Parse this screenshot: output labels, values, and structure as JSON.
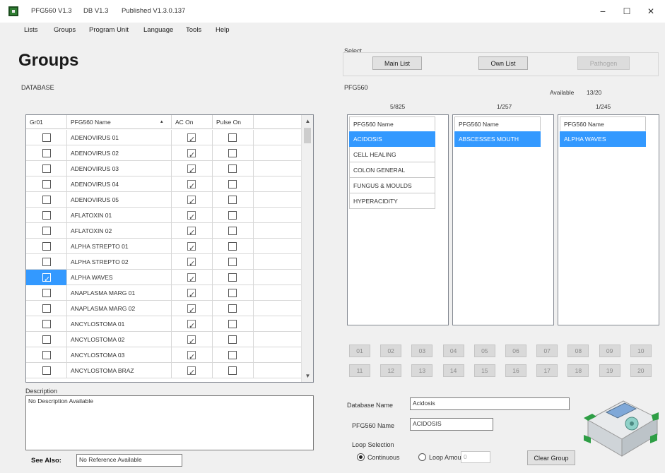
{
  "titlebar": {
    "app_version": "PFG560 V1.3",
    "db_version": "DB V1.3",
    "published": "Published V1.3.0.137",
    "minimize": "−",
    "maximize": "☐",
    "close": "✕"
  },
  "menu": [
    "Lists",
    "Groups",
    "Program Unit",
    "Language",
    "Tools",
    "Help"
  ],
  "page_title": "Groups",
  "database_label": "DATABASE",
  "select": {
    "label": "Select",
    "main_list": "Main List",
    "own_list": "Own List",
    "pathogen": "Pathogen"
  },
  "grid": {
    "headers": [
      "Gr01",
      "PFG560 Name",
      "▴",
      "AC On",
      "Pulse On"
    ],
    "rows": [
      {
        "gr": false,
        "name": "ADENOVIRUS 01",
        "ac": true,
        "pulse": false
      },
      {
        "gr": false,
        "name": "ADENOVIRUS 02",
        "ac": true,
        "pulse": false
      },
      {
        "gr": false,
        "name": "ADENOVIRUS 03",
        "ac": true,
        "pulse": false
      },
      {
        "gr": false,
        "name": "ADENOVIRUS 04",
        "ac": true,
        "pulse": false
      },
      {
        "gr": false,
        "name": "ADENOVIRUS 05",
        "ac": true,
        "pulse": false
      },
      {
        "gr": false,
        "name": "AFLATOXIN 01",
        "ac": true,
        "pulse": false
      },
      {
        "gr": false,
        "name": "AFLATOXIN 02",
        "ac": true,
        "pulse": false
      },
      {
        "gr": false,
        "name": "ALPHA STREPTO 01",
        "ac": true,
        "pulse": false
      },
      {
        "gr": false,
        "name": "ALPHA STREPTO 02",
        "ac": true,
        "pulse": false
      },
      {
        "gr": true,
        "name": "ALPHA WAVES",
        "ac": true,
        "pulse": false,
        "selected": true
      },
      {
        "gr": false,
        "name": "ANAPLASMA MARG 01",
        "ac": true,
        "pulse": false
      },
      {
        "gr": false,
        "name": "ANAPLASMA MARG 02",
        "ac": true,
        "pulse": false
      },
      {
        "gr": false,
        "name": "ANCYLOSTOMA 01",
        "ac": true,
        "pulse": false
      },
      {
        "gr": false,
        "name": "ANCYLOSTOMA 02",
        "ac": true,
        "pulse": false
      },
      {
        "gr": false,
        "name": "ANCYLOSTOMA 03",
        "ac": true,
        "pulse": false
      },
      {
        "gr": false,
        "name": "ANCYLOSTOMA BRAZ",
        "ac": true,
        "pulse": false
      }
    ]
  },
  "description": {
    "label": "Description",
    "value": "No Description Available"
  },
  "see_also": {
    "label": "See Also:",
    "value": "No Reference Available"
  },
  "pfg": {
    "label": "PFG560",
    "available_label": "Available",
    "available_value": "13/20",
    "lists": [
      {
        "count": "5/825",
        "header": "PFG560 Name",
        "items": [
          "ACIDOSIS",
          "CELL HEALING",
          "COLON GENERAL",
          "FUNGUS & MOULDS",
          "HYPERACIDITY"
        ],
        "selected": 0
      },
      {
        "count": "1/257",
        "header": "PFG560 Name",
        "items": [
          "ABSCESSES MOUTH"
        ],
        "selected": 0
      },
      {
        "count": "1/245",
        "header": "PFG560 Name",
        "items": [
          "ALPHA WAVES"
        ],
        "selected": 0
      }
    ]
  },
  "group_buttons": [
    "01",
    "02",
    "03",
    "04",
    "05",
    "06",
    "07",
    "08",
    "09",
    "10",
    "11",
    "12",
    "13",
    "14",
    "15",
    "16",
    "17",
    "18",
    "19",
    "20"
  ],
  "database_name": {
    "label": "Database Name",
    "value": "Acidosis"
  },
  "pfg_name": {
    "label": "PFG560 Name",
    "value": "ACIDOSIS"
  },
  "loop": {
    "label": "Loop Selection",
    "continuous": "Continuous",
    "loop_amount": "Loop Amount",
    "amount_value": "0",
    "selected": "continuous"
  },
  "clear_group": "Clear Group",
  "colors": {
    "selection": "#3399ff",
    "window_bg": "#f0f0f0"
  }
}
